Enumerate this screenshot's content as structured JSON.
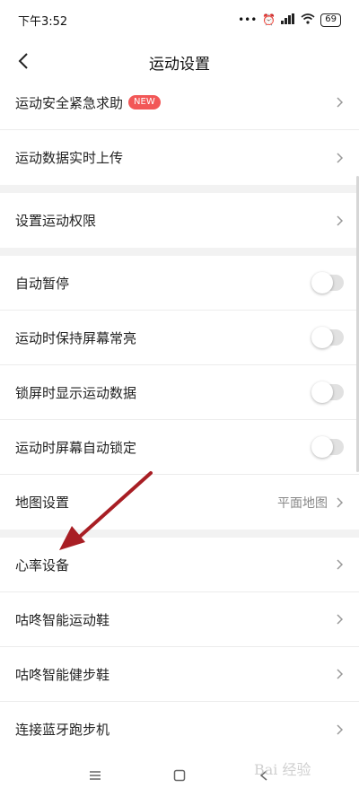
{
  "status_bar": {
    "time": "下午3:52",
    "battery": "69",
    "network": "HD"
  },
  "header": {
    "title": "运动设置"
  },
  "settings": [
    {
      "label": "运动安全紧急求助",
      "badge": "NEW",
      "type": "link"
    },
    {
      "label": "运动数据实时上传",
      "type": "link"
    },
    {
      "label": "设置运动权限",
      "type": "link"
    },
    {
      "label": "自动暂停",
      "type": "toggle",
      "on": false
    },
    {
      "label": "运动时保持屏幕常亮",
      "type": "toggle",
      "on": false
    },
    {
      "label": "锁屏时显示运动数据",
      "type": "toggle",
      "on": false
    },
    {
      "label": "运动时屏幕自动锁定",
      "type": "toggle",
      "on": false
    },
    {
      "label": "地图设置",
      "value": "平面地图",
      "type": "link"
    },
    {
      "label": "心率设备",
      "type": "link"
    },
    {
      "label": "咕咚智能运动鞋",
      "type": "link"
    },
    {
      "label": "咕咚智能健步鞋",
      "type": "link"
    },
    {
      "label": "连接蓝牙跑步机",
      "type": "link"
    }
  ],
  "watermark": "Bai 经验",
  "colors": {
    "arrow": "#a81e24",
    "badge": "#f25757",
    "section_gap": "#f2f2f2"
  }
}
